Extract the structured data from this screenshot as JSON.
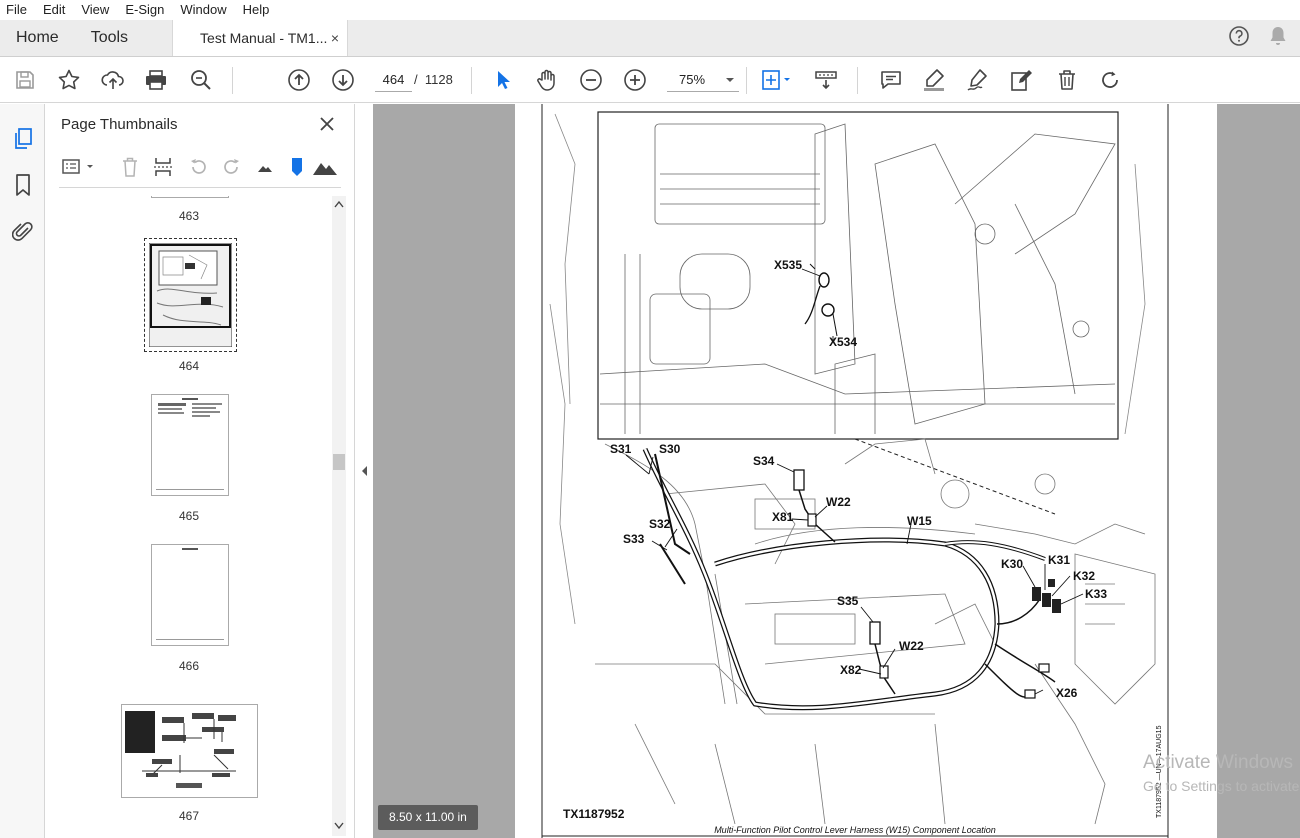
{
  "menu": [
    "File",
    "Edit",
    "View",
    "E-Sign",
    "Window",
    "Help"
  ],
  "tabs": {
    "home": "Home",
    "tools": "Tools",
    "document": "Test Manual - TM1...",
    "close": "×"
  },
  "toolbar": {
    "current_page": "464",
    "page_separator": "/",
    "total_pages": "1128",
    "zoom": "75%"
  },
  "icons": {
    "save": "save-icon",
    "bookmark_star": "star-icon",
    "upload": "upload-icon",
    "print": "print-icon",
    "zoom_search": "zoom-search-icon",
    "prev_page": "arrow-up-icon",
    "next_page": "arrow-down-icon",
    "select": "cursor-icon",
    "hand": "hand-icon",
    "zoom_out": "minus-circle-icon",
    "zoom_in": "plus-circle-icon",
    "fit": "fit-page-icon",
    "scroll_mode": "scroll-mode-icon",
    "comment": "comment-icon",
    "highlight": "highlight-icon",
    "draw": "draw-icon",
    "edit": "edit-icon",
    "delete": "trash-icon",
    "rotate": "rotate-icon",
    "help": "help-icon",
    "notifications": "bell-icon"
  },
  "sidebar": {
    "title": "Page Thumbnails",
    "close": "✕",
    "thumbnails": [
      {
        "label": "463"
      },
      {
        "label": "464",
        "selected": true
      },
      {
        "label": "465"
      },
      {
        "label": "466"
      },
      {
        "label": "467"
      }
    ]
  },
  "page": {
    "labels": {
      "x535": "X535",
      "x534": "X534",
      "s31": "S31",
      "s30": "S30",
      "s34": "S34",
      "w22_top": "W22",
      "x81": "X81",
      "w15": "W15",
      "s32": "S32",
      "s33": "S33",
      "k30": "K30",
      "k31": "K31",
      "k32": "K32",
      "k33": "K33",
      "s35": "S35",
      "w22_bottom": "W22",
      "x82": "X82",
      "x26": "X26"
    },
    "figure_id": "TX1187952",
    "side_code": "TX1187952 —UN—17AUG15",
    "caption": "Multi-Function Pilot Control Lever Harness (W15) Component Location"
  },
  "page_size": "8.50 x 11.00 in",
  "watermark": {
    "line1": "Activate Windows",
    "line2": "Go to Settings to activate"
  },
  "colors": {
    "accent_blue": "#1473e6",
    "doc_background": "#a8a8a8"
  }
}
